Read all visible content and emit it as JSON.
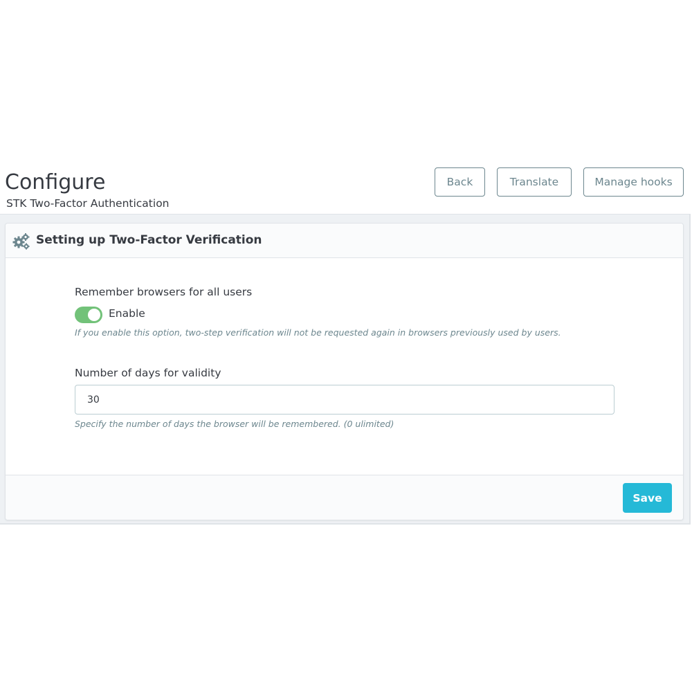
{
  "header": {
    "title": "Configure",
    "subtitle": "STK Two-Factor Authentication",
    "buttons": {
      "back": "Back",
      "translate": "Translate",
      "manage_hooks": "Manage hooks"
    }
  },
  "panel": {
    "icon": "gears-icon",
    "title": "Setting up Two-Factor Verification",
    "remember": {
      "label": "Remember browsers for all users",
      "toggle_state": "on",
      "toggle_label": "Enable",
      "help": "If you enable this option, two-step verification will not be requested again in browsers previously used by users."
    },
    "days": {
      "label": "Number of days for validity",
      "value": "30",
      "help": "Specify the number of days the browser will be remembered. (0 ulimited)"
    },
    "save_label": "Save"
  },
  "colors": {
    "accent": "#25b9d7",
    "toggle_on": "#72c279",
    "text": "#363a41",
    "muted": "#6c868e"
  }
}
